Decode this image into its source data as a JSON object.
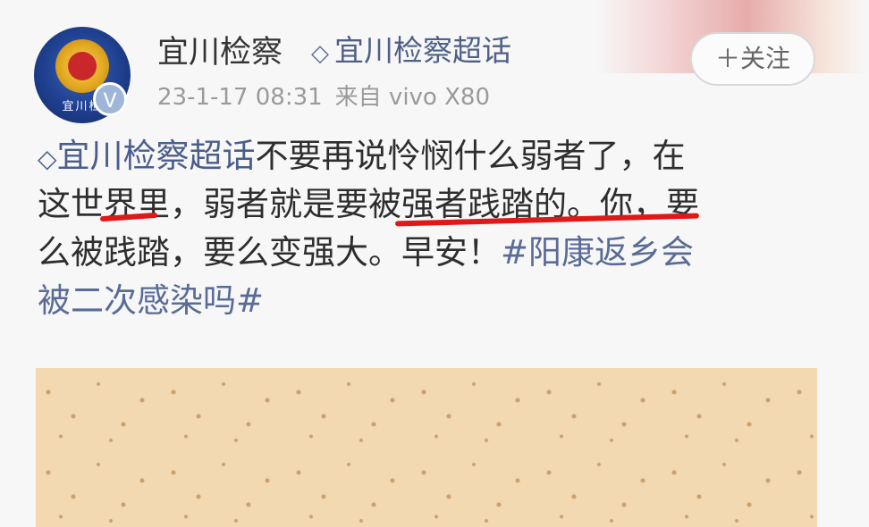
{
  "post": {
    "author": {
      "name": "宜川检察",
      "avatar_text": "宜川检",
      "verified_icon": "verified-v-icon",
      "topic_label": "宜川检察超话"
    },
    "meta": {
      "time": "23-1-17 08:31",
      "source": "来自 vivo X80"
    },
    "follow_button": "＋关注",
    "content": {
      "topic_link": "宜川检察超话",
      "line1_text": "不要再说怜悯什么弱者了，在",
      "line2_text": "这世界里，弱者就是要被强者践踏的。你，要",
      "line3_text": "么被践踏，要么变强大。早安！",
      "hashtag_part1": "#阳康返乡会",
      "hashtag_part2": "被二次感染吗#"
    },
    "annotations": {
      "mark_color": "#e01818"
    },
    "colors": {
      "link": "#4b5d8c",
      "photo_bg": "#f3d9b1"
    }
  }
}
